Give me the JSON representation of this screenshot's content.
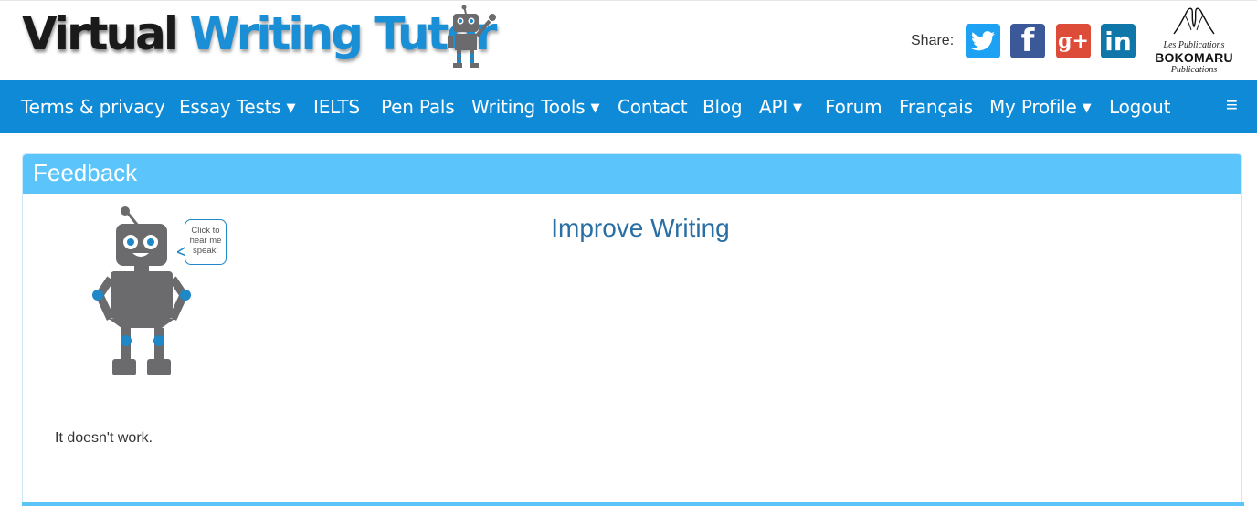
{
  "header": {
    "logo": {
      "word1": "Virtual",
      "word2": "Writing Tutor"
    },
    "share_label": "Share:",
    "social": [
      {
        "name": "twitter",
        "icon": "twitter-bird-icon",
        "glyph": "",
        "color": "#1da1f2"
      },
      {
        "name": "facebook",
        "icon": "facebook-icon",
        "glyph": "f",
        "color": "#3b5998"
      },
      {
        "name": "google-plus",
        "icon": "google-plus-icon",
        "glyph": "g+",
        "color": "#dd4b39"
      },
      {
        "name": "linkedin",
        "icon": "linkedin-icon",
        "glyph": "in",
        "color": "#0e76a8"
      }
    ],
    "publisher": {
      "line1": "Les Publications",
      "line2": "BOKOMARU",
      "line3": "Publications"
    }
  },
  "nav": {
    "items": [
      {
        "label": "Terms & privacy",
        "dropdown": false
      },
      {
        "label": "Essay Tests",
        "dropdown": true
      },
      {
        "label": "IELTS",
        "dropdown": false
      },
      {
        "label": "Pen Pals",
        "dropdown": false
      },
      {
        "label": "Writing Tools",
        "dropdown": true
      },
      {
        "label": "Contact",
        "dropdown": false
      },
      {
        "label": "Blog",
        "dropdown": false
      },
      {
        "label": "API",
        "dropdown": true
      },
      {
        "label": "Forum",
        "dropdown": false
      },
      {
        "label": "Français",
        "dropdown": false
      },
      {
        "label": "My Profile",
        "dropdown": true
      },
      {
        "label": "Logout",
        "dropdown": false
      }
    ],
    "dropdown_glyph": "❯",
    "menu_icon": "hamburger-menu-icon",
    "menu_glyph": "≡"
  },
  "panel": {
    "title": "Feedback",
    "robot_bubble": "Click to hear me speak!",
    "heading": "Improve Writing",
    "feedback_text": "It doesn't work."
  },
  "colors": {
    "nav_bg": "#0e8ad6",
    "panel_header": "#5bc5fb",
    "heading_text": "#2a6fa4",
    "robot_body": "#6b6b6e",
    "robot_accent": "#1e88c8"
  }
}
